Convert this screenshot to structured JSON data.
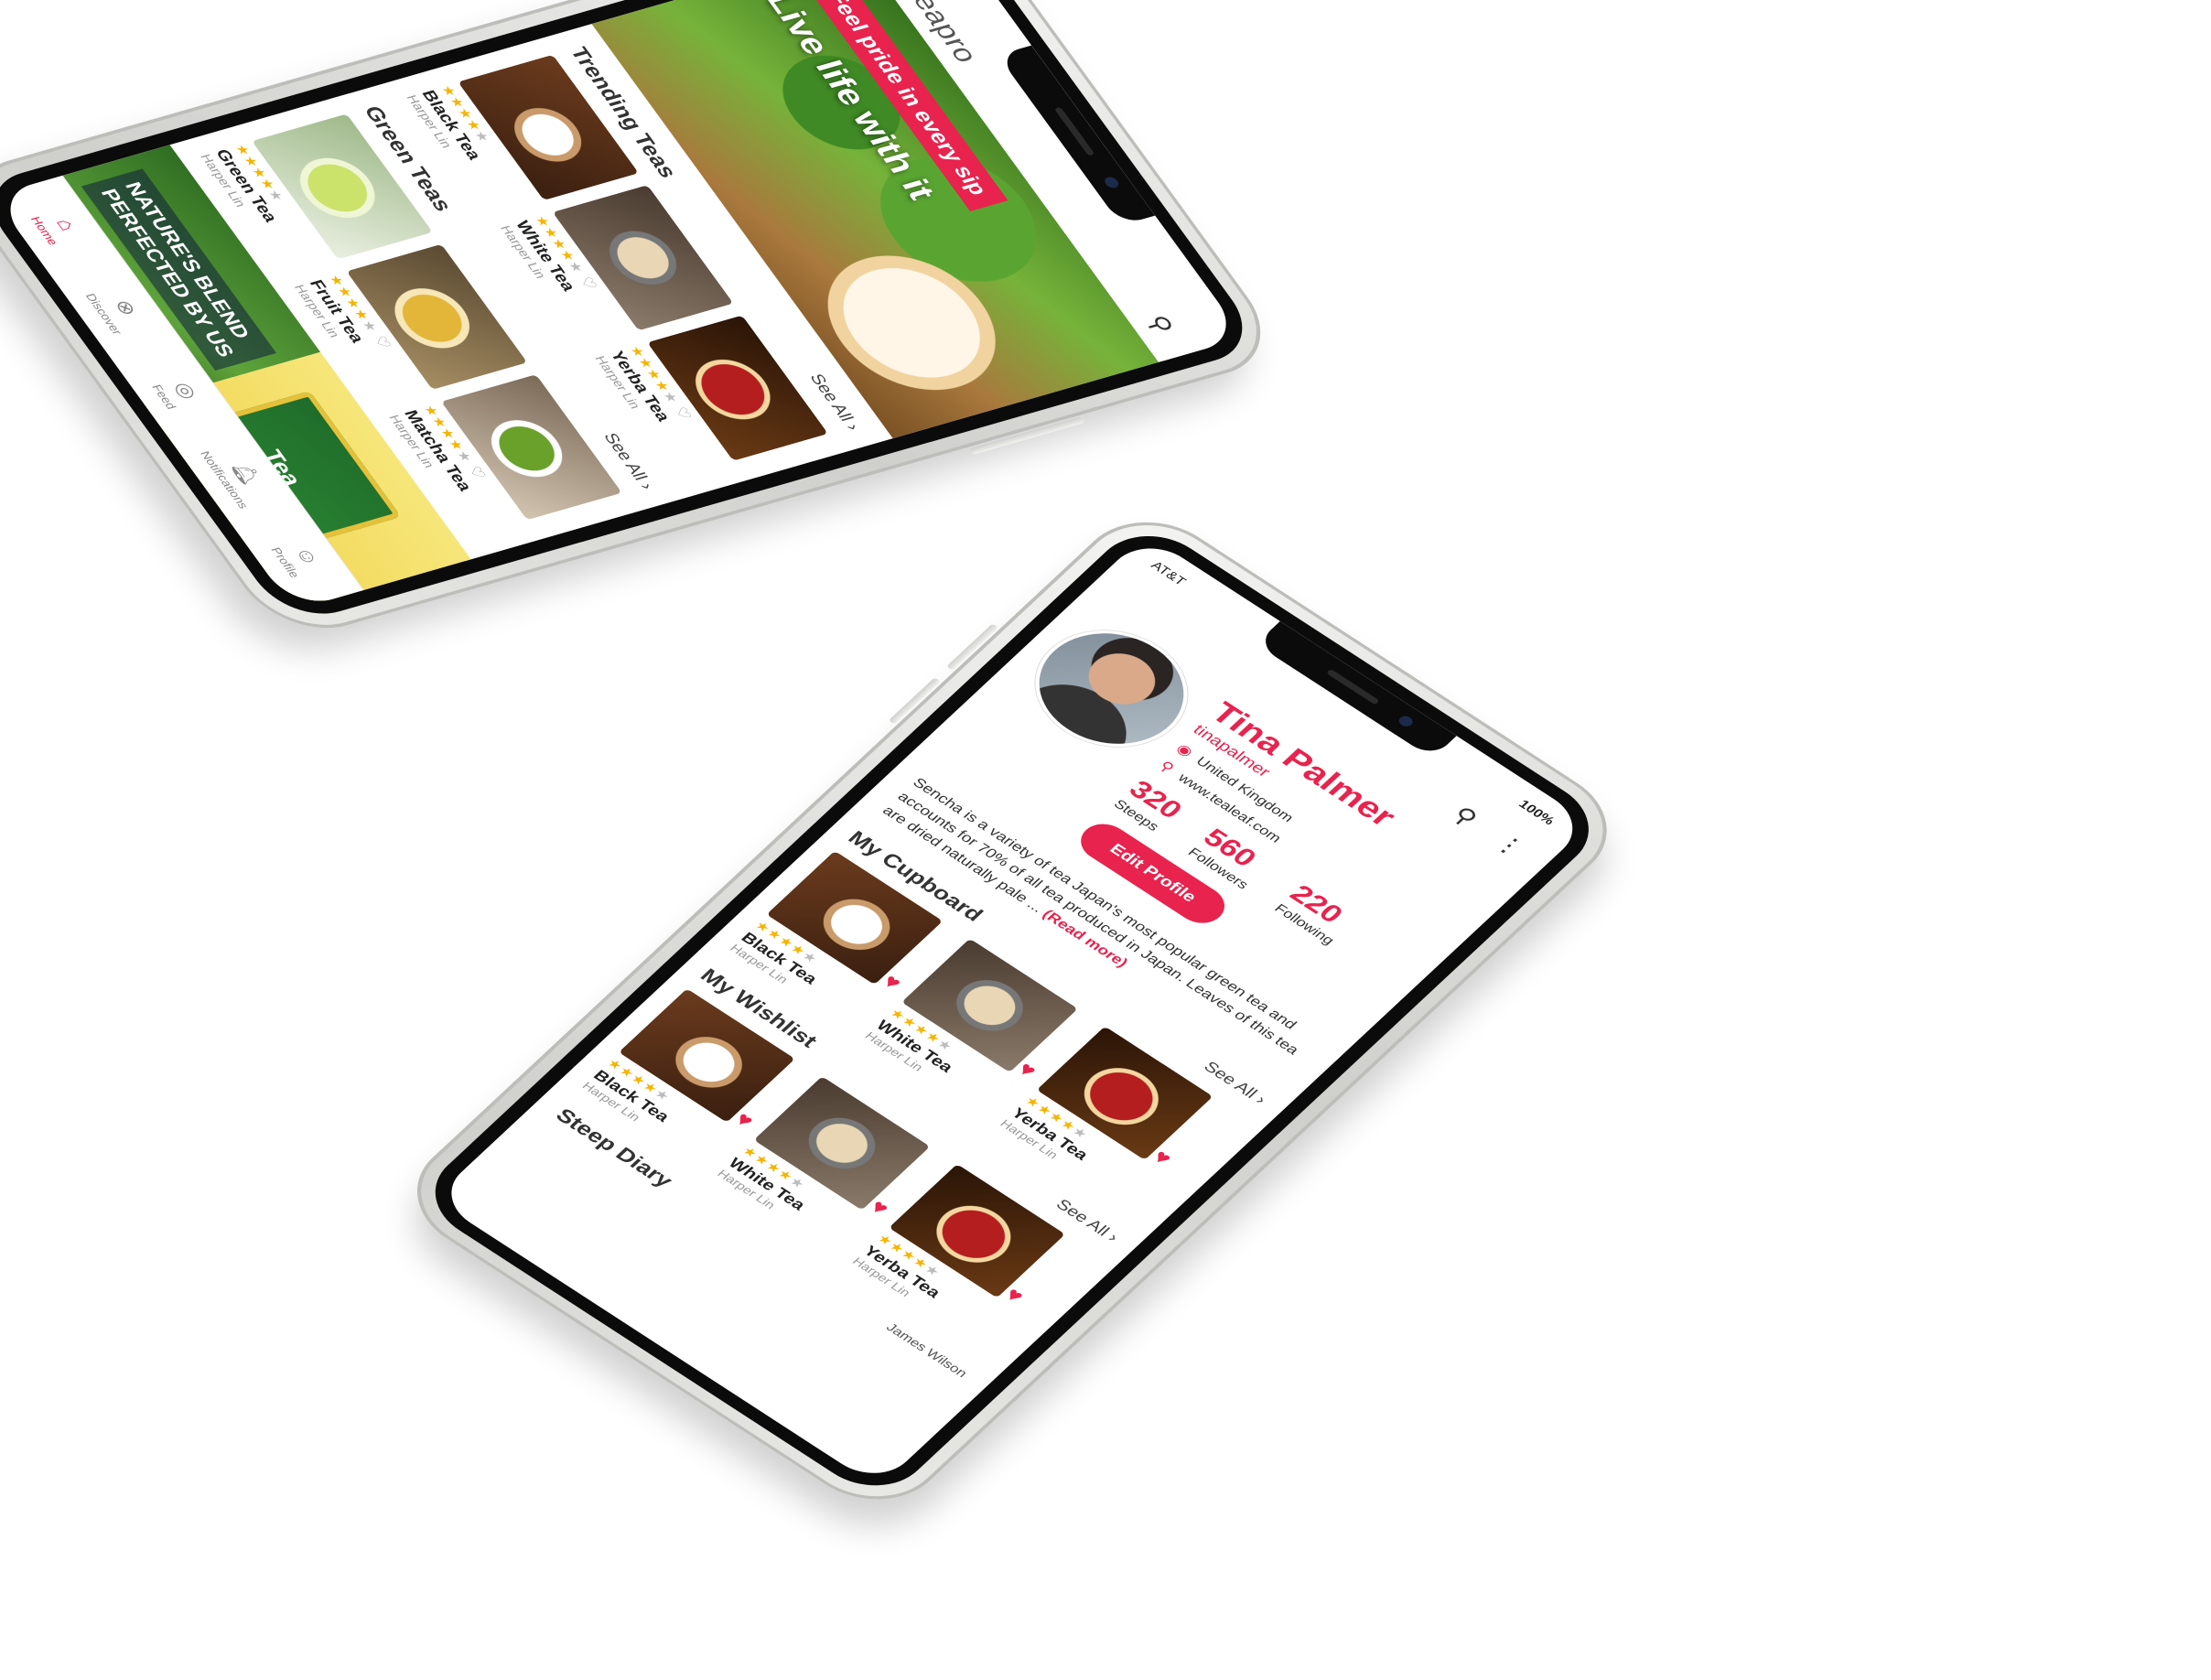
{
  "home": {
    "logo_text": "teapro",
    "hero": {
      "tag": "Feel pride in every sip",
      "headline": "Live life with it"
    },
    "trending": {
      "title": "Trending Teas",
      "see_all": "See All",
      "items": [
        {
          "name": "Black Tea",
          "author": "Harper Lin",
          "rating": 4
        },
        {
          "name": "White Tea",
          "author": "Harper Lin",
          "rating": 4
        },
        {
          "name": "Yerba Tea",
          "author": "Harper Lin",
          "rating": 4
        }
      ]
    },
    "green": {
      "title": "Green Teas",
      "see_all": "See All",
      "items": [
        {
          "name": "Green Tea",
          "author": "Harper Lin",
          "rating": 4
        },
        {
          "name": "Fruit Tea",
          "author": "Harper Lin",
          "rating": 4
        },
        {
          "name": "Matcha Tea",
          "author": "Harper Lin",
          "rating": 4
        }
      ]
    },
    "banners": {
      "a_line1": "NATURE'S BLEND",
      "a_line2": "PERFECTED BY US",
      "b_pack": "Tea"
    },
    "tabs": [
      "Home",
      "Discover",
      "Feed",
      "Notifications",
      "Profile"
    ]
  },
  "profile": {
    "status": {
      "carrier": "AT&T",
      "battery": "100%"
    },
    "name": "Tina Palmer",
    "username": "tinapalmer",
    "location": "United Kingdom",
    "website": "www.tealeaf.com",
    "stats": [
      {
        "num": "320",
        "label": "Steeps"
      },
      {
        "num": "560",
        "label": "Followers"
      },
      {
        "num": "220",
        "label": "Following"
      }
    ],
    "edit_label": "Edit Profile",
    "bio": "Sencha is a variety of tea Japan's most popular green tea and accounts for 70% of all tea produced in Japan. Leaves of this tea are dried naturally pale ...",
    "read_more": "(Read more)",
    "cupboard": {
      "title": "My Cupboard",
      "see_all": "See All",
      "items": [
        {
          "name": "Black Tea",
          "author": "Harper Lin",
          "rating": 4
        },
        {
          "name": "White Tea",
          "author": "Harper Lin",
          "rating": 4
        },
        {
          "name": "Yerba Tea",
          "author": "Harper Lin",
          "rating": 4
        }
      ]
    },
    "wishlist": {
      "title": "My Wishlist",
      "see_all": "See All",
      "items": [
        {
          "name": "Black Tea",
          "author": "Harper Lin",
          "rating": 4
        },
        {
          "name": "White Tea",
          "author": "Harper Lin",
          "rating": 4
        },
        {
          "name": "Yerba Tea",
          "author": "Harper Lin",
          "rating": 4
        }
      ]
    },
    "diary_title": "Steep Diary",
    "diary_name": "James Wilson"
  },
  "icons": {
    "search": "search-icon",
    "more": "more-icon",
    "heart": "heart-icon",
    "location": "location-icon"
  },
  "colors": {
    "accent": "#e8234e",
    "star": "#f5b400"
  }
}
